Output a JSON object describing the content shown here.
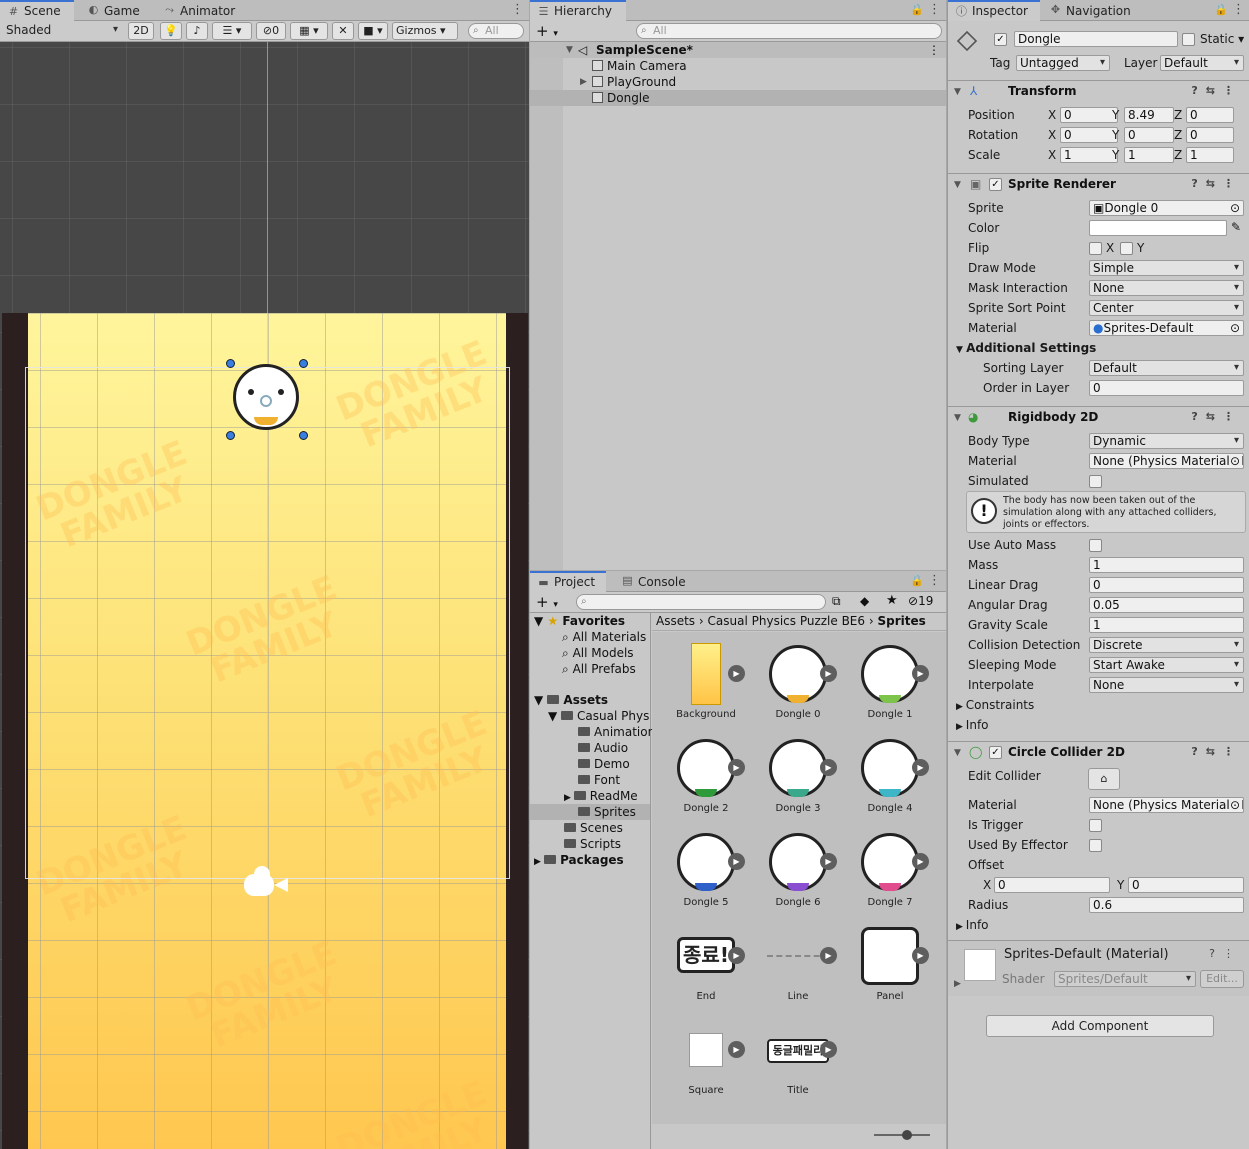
{
  "scene_tabs": [
    {
      "label": "Scene",
      "icon": "grid-icon"
    },
    {
      "label": "Game",
      "icon": "gamepad-icon"
    },
    {
      "label": "Animator",
      "icon": "animator-icon"
    }
  ],
  "scene_toolbar": {
    "shading": "Shaded",
    "mode_2d": "2D",
    "hidden_count": "0",
    "gizmos": "Gizmos",
    "search_placeholder": "All"
  },
  "scene_watermark": "DONGLE FAMILY",
  "hierarchy": {
    "tab": "Hierarchy",
    "search_placeholder": "All",
    "scene": "SampleScene*",
    "items": [
      "Main Camera",
      "PlayGround",
      "Dongle"
    ]
  },
  "project": {
    "tabs": [
      "Project",
      "Console"
    ],
    "hidden_count": "19",
    "favorites": {
      "label": "Favorites",
      "items": [
        "All Materials",
        "All Models",
        "All Prefabs"
      ]
    },
    "tree": {
      "assets": "Assets",
      "casual": "Casual Phys",
      "children": [
        "Animation",
        "Audio",
        "Demo",
        "Font",
        "ReadMe",
        "Sprites"
      ],
      "more": [
        "Scenes",
        "Scripts"
      ],
      "packages": "Packages"
    },
    "breadcrumb": [
      "Assets",
      "Casual Physics Puzzle BE6",
      "Sprites"
    ],
    "assets": [
      "Background",
      "Dongle 0",
      "Dongle 1",
      "Dongle 2",
      "Dongle 3",
      "Dongle 4",
      "Dongle 5",
      "Dongle 6",
      "Dongle 7",
      "End",
      "Line",
      "Panel",
      "Square",
      "Title"
    ],
    "end_text": "종료!",
    "title_text": "동글패밀리"
  },
  "inspector": {
    "tabs": [
      "Inspector",
      "Navigation"
    ],
    "name": "Dongle",
    "static": "Static",
    "tag_label": "Tag",
    "tag": "Untagged",
    "layer_label": "Layer",
    "layer": "Default",
    "transform": {
      "title": "Transform",
      "position_label": "Position",
      "rotation_label": "Rotation",
      "scale_label": "Scale",
      "position": [
        "0",
        "8.49",
        "0"
      ],
      "rotation": [
        "0",
        "0",
        "0"
      ],
      "scale": [
        "1",
        "1",
        "1"
      ]
    },
    "sprite_renderer": {
      "title": "Sprite Renderer",
      "labels": [
        "Sprite",
        "Color",
        "Flip",
        "Draw Mode",
        "Mask Interaction",
        "Sprite Sort Point",
        "Material"
      ],
      "sprite": "Dongle 0",
      "draw_mode": "Simple",
      "mask": "None",
      "sort_point": "Center",
      "material": "Sprites-Default",
      "additional": "Additional Settings",
      "sorting_layer_label": "Sorting Layer",
      "sorting_layer": "Default",
      "order_label": "Order in Layer",
      "order": "0"
    },
    "rigidbody": {
      "title": "Rigidbody 2D",
      "labels": [
        "Body Type",
        "Material",
        "Simulated"
      ],
      "body_type": "Dynamic",
      "material": "None (Physics Material 2D)",
      "warning": "The body has now been taken out of the simulation along with any attached colliders, joints or effectors.",
      "labels2": [
        "Use Auto Mass",
        "Mass",
        "Linear Drag",
        "Angular Drag",
        "Gravity Scale",
        "Collision Detection",
        "Sleeping Mode",
        "Interpolate"
      ],
      "mass": "1",
      "linear_drag": "0",
      "angular_drag": "0.05",
      "gravity": "1",
      "collision": "Discrete",
      "sleeping": "Start Awake",
      "interpolate": "None",
      "constraints": "Constraints",
      "info": "Info"
    },
    "collider": {
      "title": "Circle Collider 2D",
      "labels": [
        "Edit Collider",
        "Material",
        "Is Trigger",
        "Used By Effector",
        "Offset",
        "Radius"
      ],
      "material": "None (Physics Material 2D)",
      "offset_x": "0",
      "offset_y": "0",
      "radius": "0.6",
      "info": "Info"
    },
    "material": {
      "title": "Sprites-Default (Material)",
      "shader_label": "Shader",
      "shader": "Sprites/Default",
      "edit": "Edit..."
    },
    "add_component": "Add Component"
  }
}
